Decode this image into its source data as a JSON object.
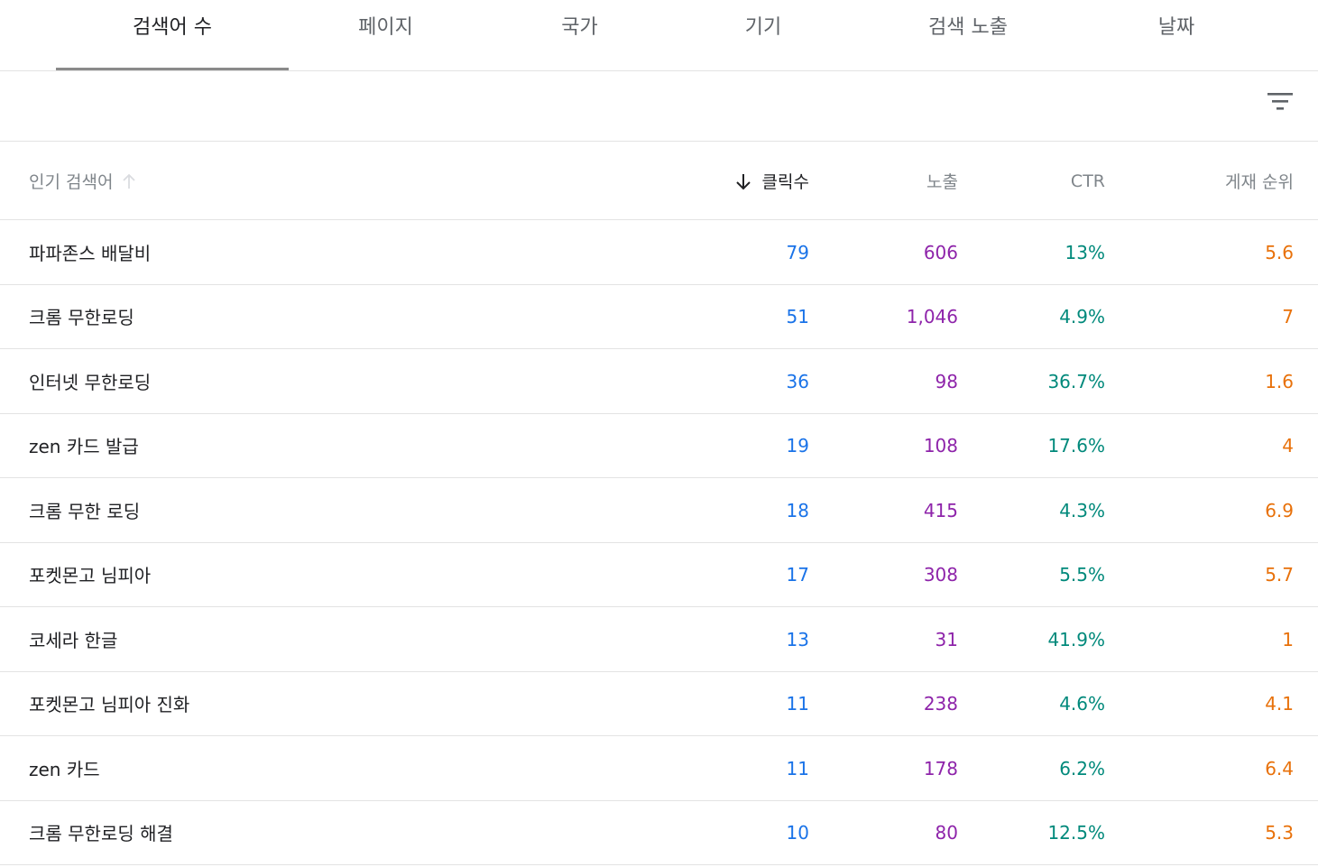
{
  "tabs": [
    {
      "label": "검색어 수",
      "active": true
    },
    {
      "label": "페이지",
      "active": false
    },
    {
      "label": "국가",
      "active": false
    },
    {
      "label": "기기",
      "active": false
    },
    {
      "label": "검색 노출",
      "active": false
    },
    {
      "label": "날짜",
      "active": false
    }
  ],
  "toolbar": {
    "filter_icon": "filter-list-icon"
  },
  "table": {
    "headers": {
      "query": "인기 검색어",
      "clicks": "클릭수",
      "impressions": "노출",
      "ctr": "CTR",
      "position": "게재 순위"
    },
    "sort": {
      "column": "clicks",
      "direction": "desc"
    },
    "rows": [
      {
        "query": "파파존스 배달비",
        "clicks": "79",
        "impressions": "606",
        "ctr": "13%",
        "position": "5.6"
      },
      {
        "query": "크롬 무한로딩",
        "clicks": "51",
        "impressions": "1,046",
        "ctr": "4.9%",
        "position": "7"
      },
      {
        "query": "인터넷 무한로딩",
        "clicks": "36",
        "impressions": "98",
        "ctr": "36.7%",
        "position": "1.6"
      },
      {
        "query": "zen 카드 발급",
        "clicks": "19",
        "impressions": "108",
        "ctr": "17.6%",
        "position": "4"
      },
      {
        "query": "크롬 무한 로딩",
        "clicks": "18",
        "impressions": "415",
        "ctr": "4.3%",
        "position": "6.9"
      },
      {
        "query": "포켓몬고 님피아",
        "clicks": "17",
        "impressions": "308",
        "ctr": "5.5%",
        "position": "5.7"
      },
      {
        "query": "코세라 한글",
        "clicks": "13",
        "impressions": "31",
        "ctr": "41.9%",
        "position": "1"
      },
      {
        "query": "포켓몬고 님피아 진화",
        "clicks": "11",
        "impressions": "238",
        "ctr": "4.6%",
        "position": "4.1"
      },
      {
        "query": "zen 카드",
        "clicks": "11",
        "impressions": "178",
        "ctr": "6.2%",
        "position": "6.4"
      },
      {
        "query": "크롬 무한로딩 해결",
        "clicks": "10",
        "impressions": "80",
        "ctr": "12.5%",
        "position": "5.3"
      }
    ]
  },
  "colors": {
    "clicks": "#1a73e8",
    "impressions": "#8e24aa",
    "ctr": "#00897b",
    "position": "#e8710a"
  }
}
